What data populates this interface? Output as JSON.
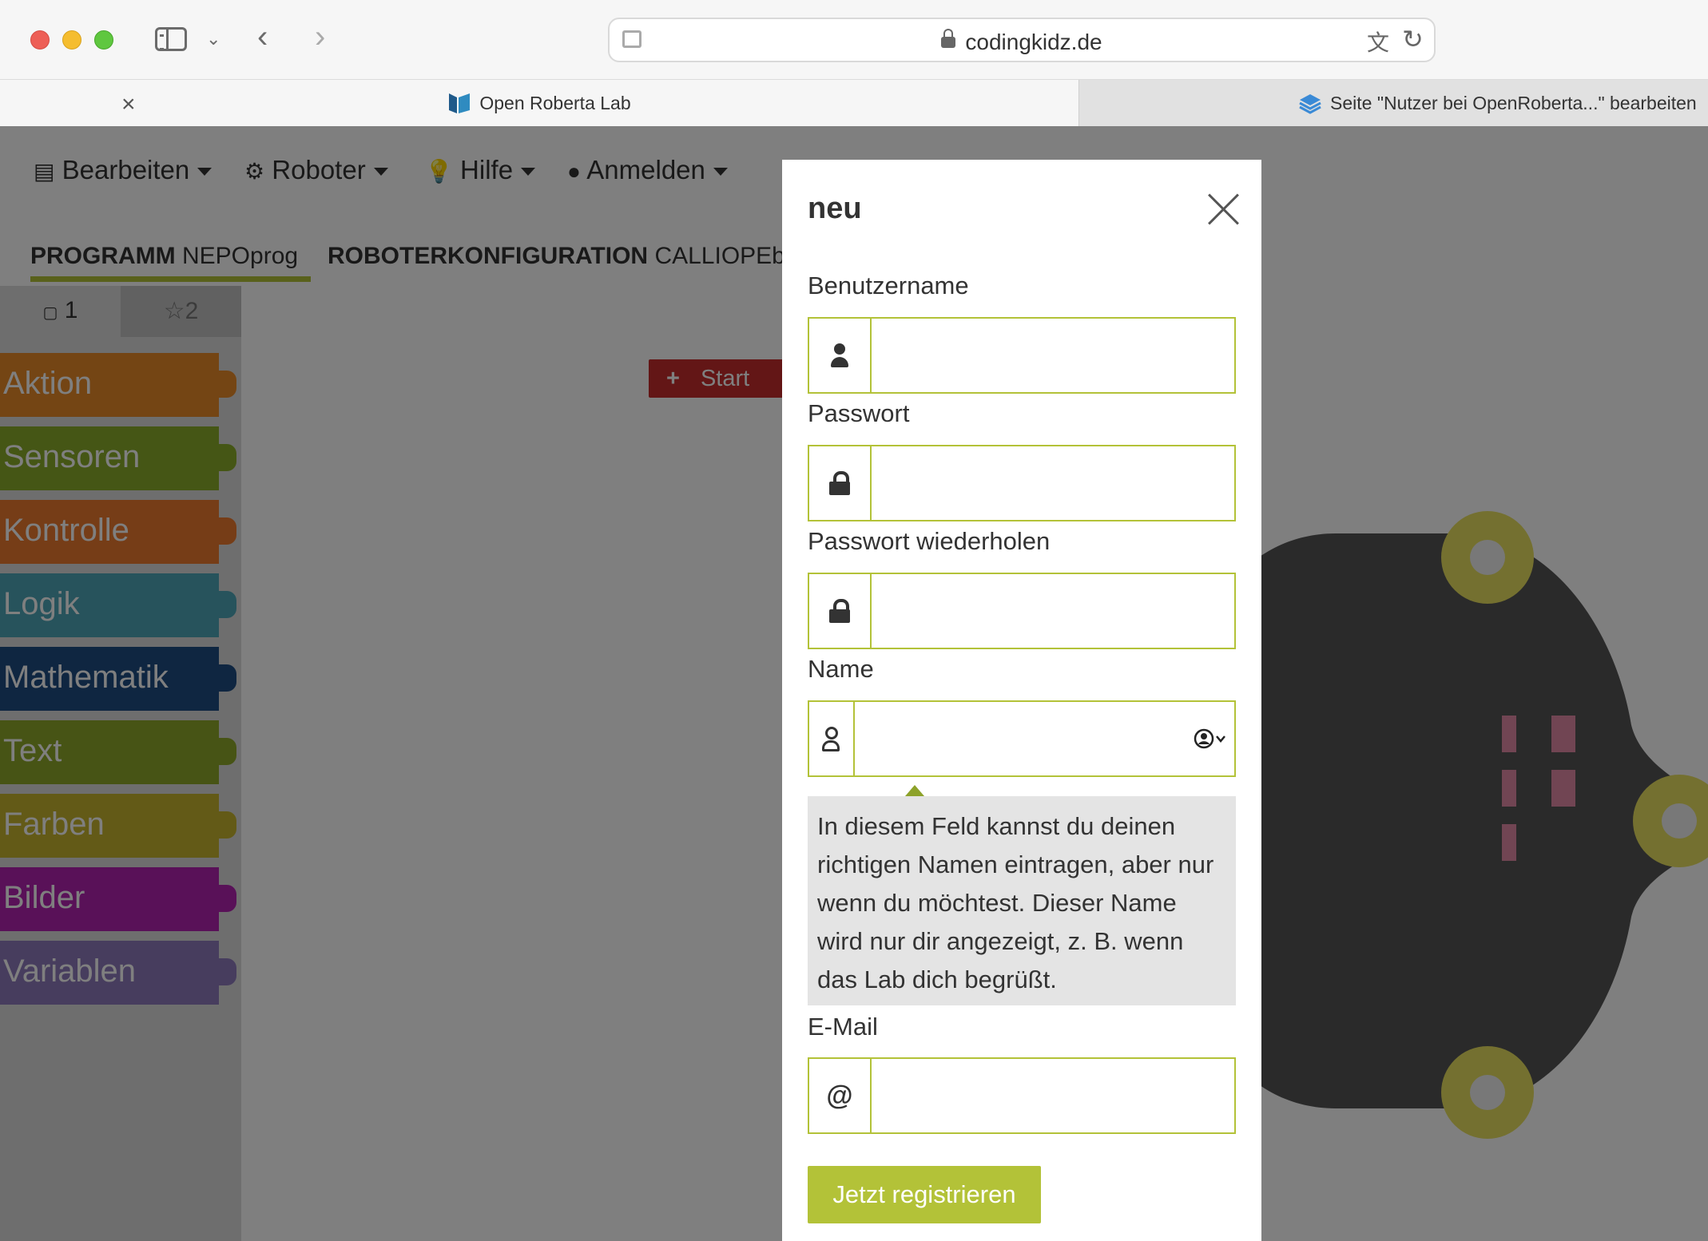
{
  "browser": {
    "url": "codingkidz.de",
    "tabs": [
      {
        "title": "Open Roberta Lab",
        "active": true
      },
      {
        "title": "Seite \"Nutzer bei OpenRoberta...\" bearbeiten",
        "active": false
      }
    ]
  },
  "app": {
    "menu": [
      {
        "label": "Bearbeiten",
        "icon": "document-icon"
      },
      {
        "label": "Roboter",
        "icon": "robot-icon"
      },
      {
        "label": "Hilfe",
        "icon": "lightbulb-icon"
      },
      {
        "label": "Anmelden",
        "icon": "user-icon"
      }
    ],
    "program_tab": {
      "prefix": "PROGRAMM",
      "name": "NEPOprog"
    },
    "config_tab": {
      "prefix": "ROBOTERKONFIGURATION",
      "name": "CALLIOPEba"
    },
    "toolbox_tabs": [
      {
        "label": "1",
        "icon": "square-icon"
      },
      {
        "label": "2",
        "icon": "star-icon"
      }
    ],
    "categories": [
      {
        "label": "Aktion",
        "color": "#e98a28"
      },
      {
        "label": "Sensoren",
        "color": "#8aac2a"
      },
      {
        "label": "Kontrolle",
        "color": "#ec7a2e"
      },
      {
        "label": "Logik",
        "color": "#4ea7b8"
      },
      {
        "label": "Mathematik",
        "color": "#1f4d83"
      },
      {
        "label": "Text",
        "color": "#8ea82b"
      },
      {
        "label": "Farben",
        "color": "#c7b52e"
      },
      {
        "label": "Bilder",
        "color": "#b222b1"
      },
      {
        "label": "Variablen",
        "color": "#8f7abd"
      }
    ],
    "start_block": {
      "label": "Start",
      "color": "#c62d2d"
    }
  },
  "modal": {
    "title": "neu",
    "fields": [
      {
        "label": "Benutzername",
        "icon": "user-icon",
        "value": ""
      },
      {
        "label": "Passwort",
        "icon": "lock-icon",
        "value": ""
      },
      {
        "label": "Passwort wiederholen",
        "icon": "lock-icon",
        "value": ""
      },
      {
        "label": "Name",
        "icon": "user-outline-icon",
        "value": ""
      },
      {
        "label": "E-Mail",
        "icon": "at-icon",
        "value": ""
      }
    ],
    "hint": "In diesem Feld kannst du deinen richtigen Namen eintragen, aber nur wenn du möchtest. Dieser Name wird nur dir angezeigt, z. B. wenn das Lab dich begrüßt.",
    "submit_label": "Jetzt registrieren",
    "accent_color": "#b3c238"
  }
}
